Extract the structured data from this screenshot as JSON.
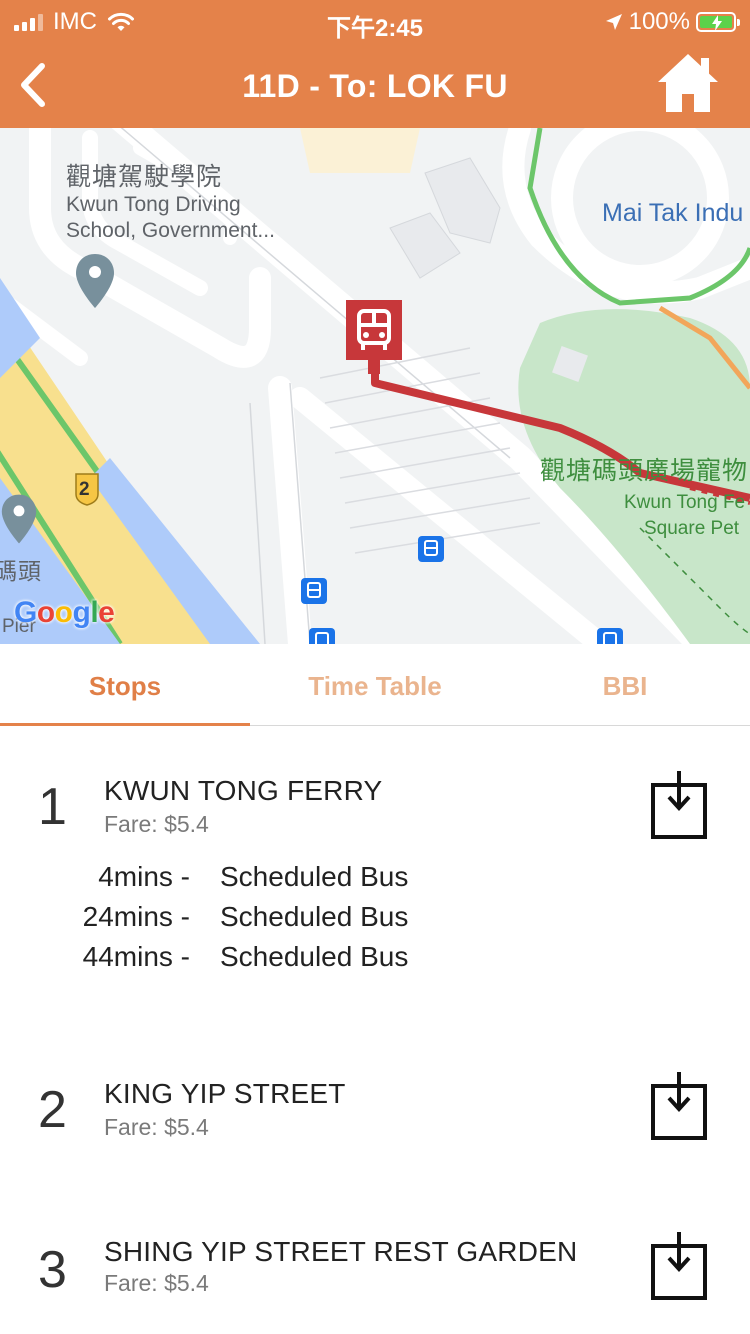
{
  "status_bar": {
    "carrier": "IMC",
    "time": "下午2:45",
    "battery": "100%"
  },
  "nav": {
    "title": "11D - To: LOK FU",
    "back_icon": "chevron-left-icon",
    "home_icon": "home-icon"
  },
  "map": {
    "labels": {
      "driving_school_cn": "觀塘駕駛學院",
      "driving_school_en1": "Kwun Tong Driving",
      "driving_school_en2": "School, Government...",
      "mai_tak": "Mai Tak Indu",
      "plaza_cn": "觀塘碼頭廣場寵物",
      "plaza_en1": "Kwun Tong Fe",
      "plaza_en2": "Square Pet",
      "pier_cn": "碼頭",
      "pier_en": "Pier",
      "route_shield": "2",
      "google": "Google"
    },
    "colors": {
      "route_line": "#C7373A",
      "park": "#C8E6C9",
      "highway": "#F8E08E",
      "water": "#AECBFA"
    }
  },
  "tabs": [
    {
      "label": "Stops",
      "active": true
    },
    {
      "label": "Time Table",
      "active": false
    },
    {
      "label": "BBI",
      "active": false
    }
  ],
  "stops": [
    {
      "number": "1",
      "name": "KWUN TONG FERRY",
      "fare": "Fare: $5.4",
      "etas": [
        {
          "mins": "4mins -",
          "desc": "Scheduled Bus"
        },
        {
          "mins": "24mins -",
          "desc": "Scheduled Bus"
        },
        {
          "mins": "44mins -",
          "desc": "Scheduled Bus"
        }
      ]
    },
    {
      "number": "2",
      "name": "KING YIP STREET",
      "fare": "Fare: $5.4"
    },
    {
      "number": "3",
      "name": "SHING YIP STREET REST GARDEN",
      "fare": "Fare: $5.4"
    }
  ],
  "theme": {
    "accent": "#E4824A",
    "tab_active": "#E07F47",
    "tab_inactive": "#EAB48E"
  }
}
